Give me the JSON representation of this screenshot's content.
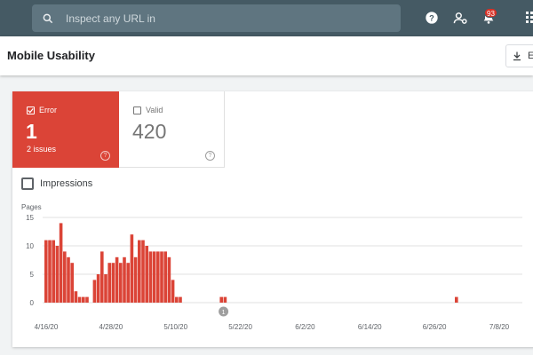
{
  "topbar": {
    "search_placeholder": "Inspect any URL in",
    "notification_count": "93",
    "colors": {
      "bar": "#455a64",
      "search": "#5f7580",
      "badge": "#d93025"
    }
  },
  "header": {
    "title": "Mobile Usability",
    "export_label": "E"
  },
  "tiles": {
    "error": {
      "label": "Error",
      "value": "1",
      "sub": "2 issues",
      "checked": true,
      "color": "#db4437"
    },
    "valid": {
      "label": "Valid",
      "value": "420",
      "checked": false
    }
  },
  "impressions_label": "Impressions",
  "chart_data": {
    "type": "bar",
    "ylabel": "Pages",
    "ylim": [
      0,
      15
    ],
    "yticks": [
      0,
      5,
      10,
      15
    ],
    "xticks": [
      "4/16/20",
      "4/28/20",
      "5/10/20",
      "5/22/20",
      "6/2/20",
      "6/14/20",
      "6/26/20",
      "7/8/20"
    ],
    "annotation": {
      "label": "1",
      "date_index": 48
    },
    "color": "#db4437",
    "values": [
      11,
      11,
      11,
      10,
      14,
      9,
      8,
      7,
      2,
      1,
      1,
      1,
      0,
      4,
      5,
      9,
      5,
      7,
      7,
      8,
      7,
      8,
      7,
      12,
      8,
      11,
      11,
      10,
      9,
      9,
      9,
      9,
      9,
      8,
      4,
      1,
      1,
      0,
      0,
      0,
      0,
      0,
      0,
      0,
      0,
      0,
      0,
      1,
      1,
      0,
      0,
      0,
      0,
      0,
      0,
      0,
      0,
      0,
      0,
      0,
      0,
      0,
      0,
      0,
      0,
      0,
      0,
      0,
      0,
      0,
      0,
      0,
      0,
      0,
      0,
      0,
      0,
      0,
      0,
      0,
      0,
      0,
      0,
      0,
      0,
      0,
      0,
      0,
      0,
      0,
      0,
      0,
      0,
      0,
      0,
      0,
      0,
      0,
      0,
      0,
      0,
      0,
      0,
      0,
      0,
      0,
      0,
      0,
      0,
      0,
      1
    ]
  }
}
